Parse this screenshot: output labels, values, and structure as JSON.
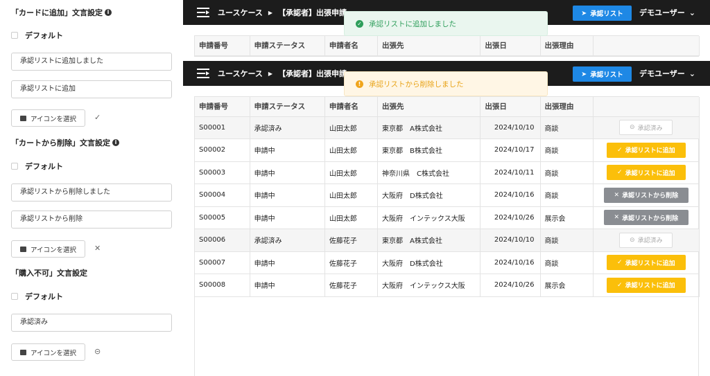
{
  "settings": [
    {
      "title": "「カードに追加」文言設定",
      "has_info": true,
      "default_label": "デフォルト",
      "inputs": [
        "承認リストに追加しました",
        "承認リストに追加"
      ],
      "icon_button": "アイコンを選択",
      "icon_glyph": "✓"
    },
    {
      "title": "「カートから削除」文言設定",
      "has_info": true,
      "default_label": "デフォルト",
      "inputs": [
        "承認リストから削除しました",
        "承認リストから削除"
      ],
      "icon_button": "アイコンを選択",
      "icon_glyph": "✕"
    },
    {
      "title": "「購入不可」文言設定",
      "has_info": false,
      "default_label": "デフォルト",
      "inputs": [
        "承認済み"
      ],
      "icon_button": "アイコンを選択",
      "icon_glyph": "⊝"
    }
  ],
  "header": {
    "breadcrumb_1": "ユースケース",
    "breadcrumb_2": "【承認者】出張申請",
    "approve_list_button": "承認リスト",
    "user_name": "デモユーザー"
  },
  "toasts": {
    "added": "承認リストに追加しました",
    "removed": "承認リストから削除しました"
  },
  "table": {
    "columns": [
      "申請番号",
      "申請ステータス",
      "申請者名",
      "出張先",
      "出張日",
      "出張理由",
      ""
    ],
    "rows": [
      {
        "id": "S00001",
        "status": "承認済み",
        "name": "山田太郎",
        "dest": "東京都　A株式会社",
        "date": "2024/10/10",
        "reason": "商談",
        "action": "承認済み",
        "kind": "done"
      },
      {
        "id": "S00002",
        "status": "申請中",
        "name": "山田太郎",
        "dest": "東京都　B株式会社",
        "date": "2024/10/17",
        "reason": "商談",
        "action": "承認リストに追加",
        "kind": "add"
      },
      {
        "id": "S00003",
        "status": "申請中",
        "name": "山田太郎",
        "dest": "神奈川県　C株式会社",
        "date": "2024/10/11",
        "reason": "商談",
        "action": "承認リストに追加",
        "kind": "add"
      },
      {
        "id": "S00004",
        "status": "申請中",
        "name": "山田太郎",
        "dest": "大阪府　D株式会社",
        "date": "2024/10/16",
        "reason": "商談",
        "action": "承認リストから削除",
        "kind": "del"
      },
      {
        "id": "S00005",
        "status": "申請中",
        "name": "山田太郎",
        "dest": "大阪府　インテックス大阪",
        "date": "2024/10/26",
        "reason": "展示会",
        "action": "承認リストから削除",
        "kind": "del"
      },
      {
        "id": "S00006",
        "status": "承認済み",
        "name": "佐藤花子",
        "dest": "東京都　A株式会社",
        "date": "2024/10/10",
        "reason": "商談",
        "action": "承認済み",
        "kind": "done"
      },
      {
        "id": "S00007",
        "status": "申請中",
        "name": "佐藤花子",
        "dest": "大阪府　D株式会社",
        "date": "2024/10/16",
        "reason": "商談",
        "action": "承認リストに追加",
        "kind": "add"
      },
      {
        "id": "S00008",
        "status": "申請中",
        "name": "佐藤花子",
        "dest": "大阪府　インテックス大阪",
        "date": "2024/10/26",
        "reason": "展示会",
        "action": "承認リストに追加",
        "kind": "add"
      }
    ]
  },
  "colors": {
    "header_bg": "#1c1c1c",
    "primary": "#1e88e5",
    "add": "#fbbf0a",
    "remove": "#8a8d92",
    "success": "#2e9e5b",
    "warning": "#f0a51c"
  }
}
